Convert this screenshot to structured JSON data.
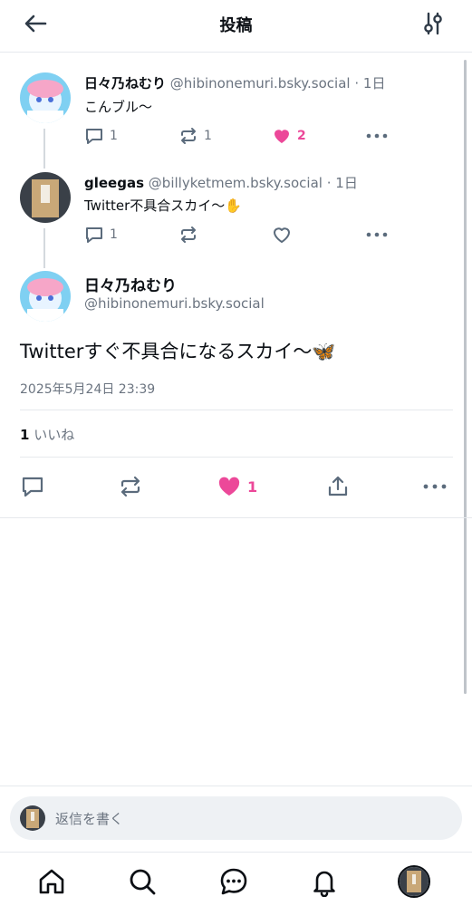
{
  "header": {
    "title": "投稿"
  },
  "thread": [
    {
      "name": "日々乃ねむり",
      "handle": "@hibinonemuri.bsky.social",
      "time": "1日",
      "text": "こんブル〜",
      "replies": "1",
      "reposts": "1",
      "likes": "2",
      "liked": true
    },
    {
      "name": "gleegas",
      "handle": "@billyketmem.bsky.social",
      "time": "1日",
      "text": "Twitter不具合スカイ〜✋",
      "replies": "1",
      "reposts": "",
      "likes": "",
      "liked": false
    }
  ],
  "main_post": {
    "name": "日々乃ねむり",
    "handle": "@hibinonemuri.bsky.social",
    "text": "Twitterすぐ不具合になるスカイ〜🦋",
    "date": "2025年5月24日 23:39",
    "likes_count": "1",
    "likes_label": "いいね",
    "like_button_count": "1"
  },
  "reply_bar": {
    "placeholder": "返信を書く"
  },
  "tabs": [
    "home",
    "search",
    "chat",
    "notifications",
    "profile"
  ],
  "colors": {
    "accent_like": "#ec4899",
    "muted": "#6b7480",
    "icon": "#5b6b7c"
  }
}
